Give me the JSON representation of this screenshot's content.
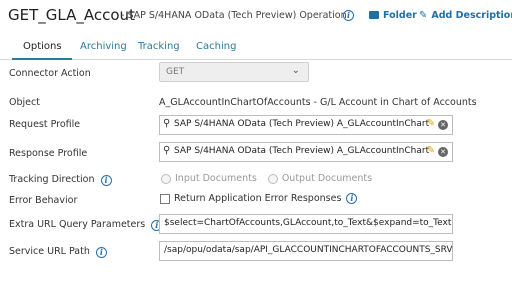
{
  "header": {
    "title": "GET_GLA_Accout",
    "subtitle": "- SAP S/4HANA OData (Tech Preview) Operation",
    "folder_label": "Folder",
    "add_description_label": "Add Description"
  },
  "tabs": [
    {
      "label": "Options",
      "active": true
    },
    {
      "label": "Archiving",
      "active": false
    },
    {
      "label": "Tracking",
      "active": false
    },
    {
      "label": "Caching",
      "active": false
    }
  ],
  "form": {
    "connector_action": {
      "label": "Connector Action",
      "value": "GET"
    },
    "object": {
      "label": "Object",
      "value": "A_GLAccountInChartOfAccounts - G/L Account in Chart of Accounts"
    },
    "request_profile": {
      "label": "Request Profile",
      "value": "SAP S/4HANA OData (Tech Preview) A_GLAccountInChart"
    },
    "response_profile": {
      "label": "Response Profile",
      "value": "SAP S/4HANA OData (Tech Preview) A_GLAccountInChart"
    },
    "tracking_direction": {
      "label": "Tracking Direction",
      "options": [
        "Input Documents",
        "Output Documents"
      ],
      "selected": "Input Documents"
    },
    "error_behavior": {
      "label": "Error Behavior",
      "checkbox_label": "Return Application Error Responses",
      "checked": false
    },
    "extra_url_query": {
      "label": "Extra URL Query Parameters",
      "value": "$select=ChartOfAccounts,GLAccount,to_Text&$expand=to_Text"
    },
    "service_url_path": {
      "label": "Service URL Path",
      "value": "/sap/opu/odata/sap/API_GLACCOUNTINCHARTOFACCOUNTS_SRV/"
    }
  },
  "colors": {
    "accent": "#2a7a9a",
    "link": "#1f6fa8",
    "edit_icon": "#e0a100"
  }
}
